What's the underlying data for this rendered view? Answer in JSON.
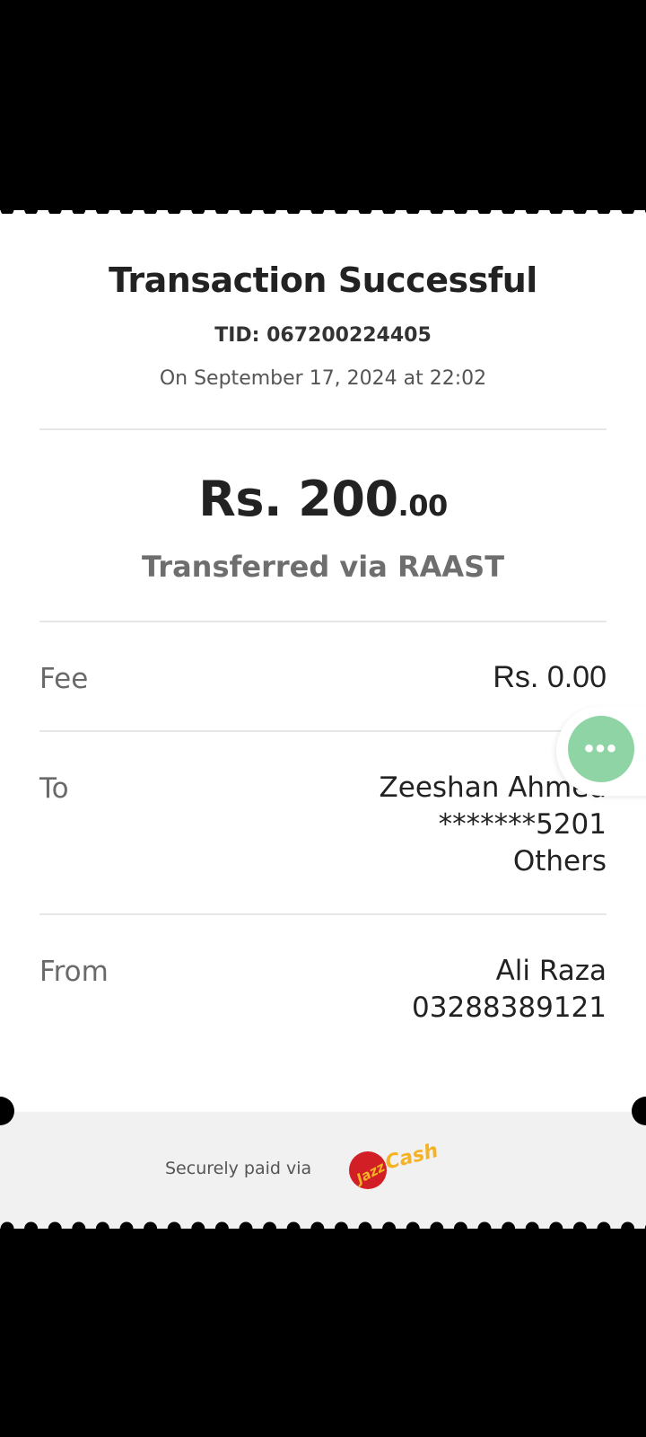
{
  "header": {
    "title": "Transaction Successful",
    "tid": "TID: 067200224405",
    "datetime": "On September 17, 2024 at 22:02"
  },
  "amount": {
    "main": "Rs. 200",
    "cents": ".00",
    "method": "Transferred via RAAST"
  },
  "details": {
    "fee": {
      "label": "Fee",
      "value": "Rs. 0.00"
    },
    "to": {
      "label": "To",
      "name": "Zeeshan Ahmed",
      "account": "*******5201",
      "bank": "Others"
    },
    "from": {
      "label": "From",
      "name": "Ali Raza",
      "number": "03288389121"
    }
  },
  "footer": {
    "text": "Securely paid via",
    "brand": "JazzCash"
  },
  "fab": {
    "icon": "more-horizontal-icon",
    "glyph": "•••",
    "color": "#8fd4a4"
  },
  "colors": {
    "background": "#000000",
    "receipt": "#ffffff",
    "footer_band": "#f1f1f1",
    "brand_red": "#d21f26",
    "brand_yellow": "#f5b323"
  }
}
